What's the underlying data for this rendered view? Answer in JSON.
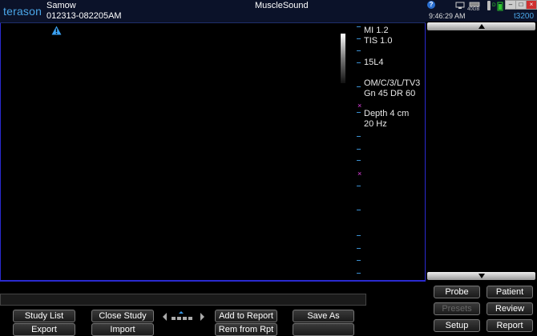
{
  "header": {
    "brand": "terason",
    "patient_name": "Samow",
    "study_id": "012313-082205AM",
    "app_title": "MuscleSound"
  },
  "image_params": {
    "mi": "MI  1.2",
    "tis": "TIS 1.0",
    "probe": "15L4",
    "mode": "OM/C/3/L/TV3",
    "gain_dr": "Gn 45   DR 60",
    "depth": "Depth 4 cm",
    "frame_rate": "20 Hz"
  },
  "status_bar": {
    "time": "9:46:29 AM",
    "model": "t3200",
    "storage": "40GB",
    "help": "?"
  },
  "colors": {
    "accent": "#4aa6e8",
    "frame_border": "#2a2ad0",
    "focus_marker": "#e040e0"
  },
  "buttons": {
    "study_list": "Study List",
    "export": "Export",
    "close_study": "Close Study",
    "import": "Import",
    "add_to_report": "Add to Report",
    "rem_from_rpt": "Rem from Rpt",
    "save_as": "Save As",
    "probe": "Probe",
    "patient": "Patient",
    "presets": "Presets",
    "review": "Review",
    "setup": "Setup",
    "report": "Report"
  }
}
